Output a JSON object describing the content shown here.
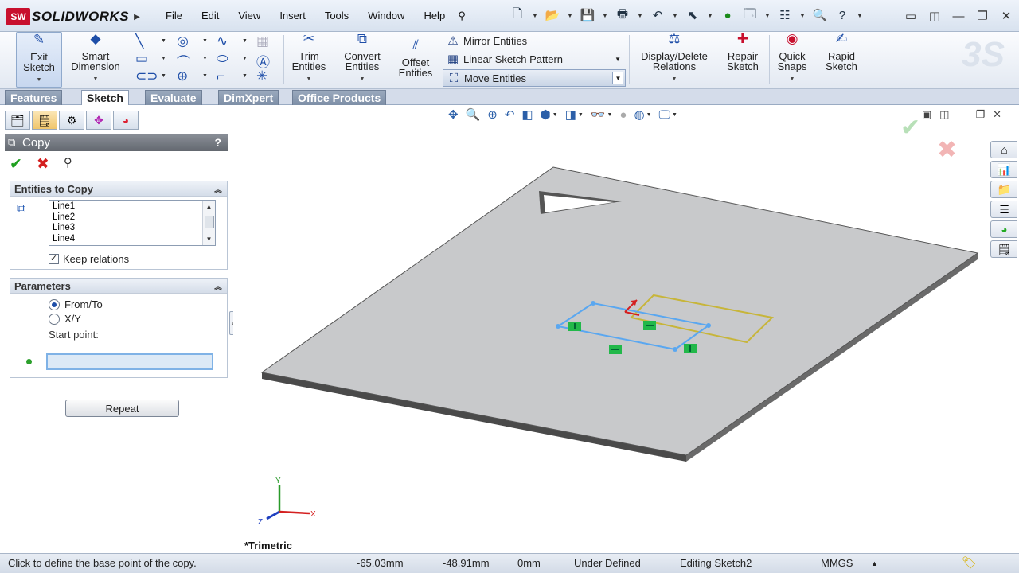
{
  "app": {
    "logo_box": "SW",
    "logo_text": "SOLIDWORKS",
    "menus": [
      "File",
      "Edit",
      "View",
      "Insert",
      "Tools",
      "Window",
      "Help"
    ]
  },
  "ribbon": {
    "exit_sketch": "Exit Sketch",
    "smart_dimension": "Smart Dimension",
    "trim_entities": "Trim Entities",
    "convert_entities": "Convert Entities",
    "offset_entities": "Offset Entities",
    "mirror_entities": "Mirror Entities",
    "linear_sketch_pattern": "Linear Sketch Pattern",
    "move_entities": "Move Entities",
    "display_delete_relations": "Display/Delete Relations",
    "repair_sketch": "Repair Sketch",
    "quick_snaps": "Quick Snaps",
    "rapid_sketch": "Rapid Sketch"
  },
  "tabs": [
    {
      "label": "Features",
      "active": false
    },
    {
      "label": "Sketch",
      "active": true
    },
    {
      "label": "Evaluate",
      "active": false
    },
    {
      "label": "DimXpert",
      "active": false
    },
    {
      "label": "Office Products",
      "active": false
    }
  ],
  "property_manager": {
    "title": "Copy",
    "help": "?",
    "entities_group": {
      "title": "Entities to Copy",
      "items": [
        "Line1",
        "Line2",
        "Line3",
        "Line4"
      ],
      "keep_relations": "Keep relations",
      "keep_relations_checked": true
    },
    "params_group": {
      "title": "Parameters",
      "option_from_to": "From/To",
      "option_xy": "X/Y",
      "selected": "From/To",
      "start_point_label": "Start point:",
      "start_point_value": ""
    },
    "repeat_label": "Repeat"
  },
  "viewport": {
    "view_label": "*Trimetric",
    "axis_x": "X",
    "axis_y": "Y",
    "axis_z": "Z"
  },
  "statusbar": {
    "message": "Click to define the base point of the copy.",
    "x": "-65.03mm",
    "y": "-48.91mm",
    "z": "0mm",
    "status": "Under Defined",
    "editing": "Editing Sketch2",
    "units": "MMGS"
  },
  "colors": {
    "plate_top": "#c8c9cb",
    "plate_edge": "#4a4a4a",
    "sketch_selected": "#5aa7f0",
    "sketch_preview": "#c7b53a",
    "relation_marker": "#22b84a"
  }
}
